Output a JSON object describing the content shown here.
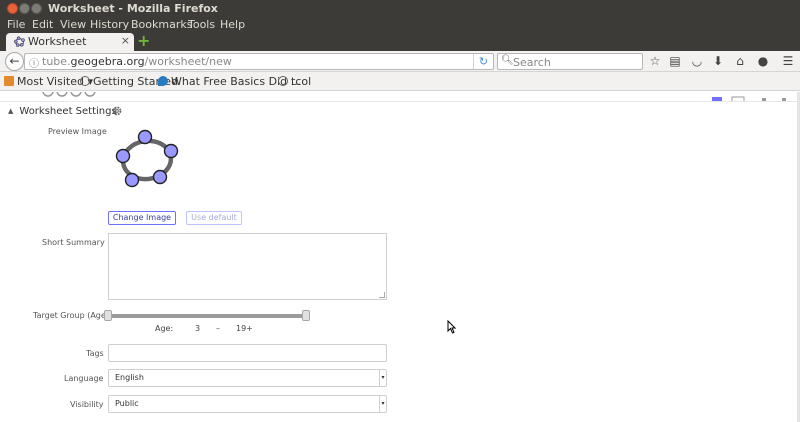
{
  "window": {
    "title": "Worksheet - Mozilla Firefox"
  },
  "menubar": {
    "items": [
      "File",
      "Edit",
      "View",
      "History",
      "Bookmarks",
      "Tools",
      "Help"
    ]
  },
  "tab": {
    "title": "Worksheet",
    "close": "×",
    "new_tab": "+"
  },
  "nav": {
    "url_prefix": "tube.",
    "url_domain": "geogebra.org",
    "url_path": "/worksheet/new",
    "search_placeholder": "Search"
  },
  "bookmarks": {
    "items": [
      "Most Visited ▾",
      "Getting Started",
      "What Free Basics Did ...",
      "tcol"
    ]
  },
  "page": {
    "section_title": "Worksheet Settings",
    "preview_label": "Preview Image",
    "change_image": "Change Image",
    "use_default": "Use default",
    "short_summary_label": "Short Summary",
    "target_group_label": "Target Group (Age)",
    "age_label": "Age:",
    "age_min": "3",
    "age_dash": "–",
    "age_max": "19+",
    "tags_label": "Tags",
    "language_label": "Language",
    "language_value": "English",
    "visibility_label": "Visibility",
    "visibility_value": "Public"
  },
  "colors": {
    "titlebar": "#3c3b37",
    "toolbar": "#f2f1f0",
    "accent_button": "#6d71ff",
    "logo_node": "#9999ff",
    "logo_ring": "#666666"
  }
}
